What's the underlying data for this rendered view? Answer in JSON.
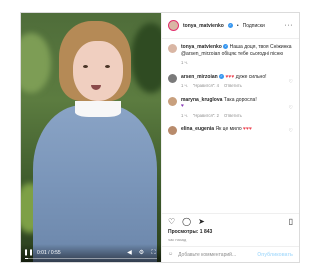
{
  "post": {
    "author": "tonya_matvienko",
    "follow_separator": "•",
    "follow_label": "Подписки",
    "more_label": "···"
  },
  "video": {
    "time": "0:01 / 0:55",
    "progress": 0.02
  },
  "comments": [
    {
      "user": "tonya_matvienko",
      "verified": true,
      "text": "Наша доця, твоя Сніжинка @arsen_mirzoian обіцяє тебе сьогодні пісню",
      "meta": [
        "1 ч."
      ]
    },
    {
      "user": "arsen_mirzoian",
      "verified": true,
      "text_prefix": "",
      "hearts": "♥♥♥",
      "text": "дуже сильно!",
      "meta": [
        "1 ч.",
        "\"Нравится\": 4",
        "Ответить"
      ]
    },
    {
      "user": "maryna_kruglova",
      "verified": false,
      "text": "Така доросла!",
      "emoji": "♥",
      "meta": [
        "1 ч.",
        "\"Нравится\": 2",
        "Ответить"
      ]
    },
    {
      "user": "elina_eugenia",
      "verified": false,
      "text": "Як це мило",
      "hearts": "♥♥♥",
      "meta": []
    }
  ],
  "actions": {
    "views_label": "Просмотры: 1 843",
    "ago": "час назад"
  },
  "add_comment": {
    "placeholder": "Добавьте комментарий...",
    "post_label": "Опубликовать"
  },
  "icons": {
    "like": "heart-icon",
    "comment": "comment-icon",
    "share": "share-icon",
    "save": "bookmark-icon",
    "emoji": "emoji-icon"
  }
}
